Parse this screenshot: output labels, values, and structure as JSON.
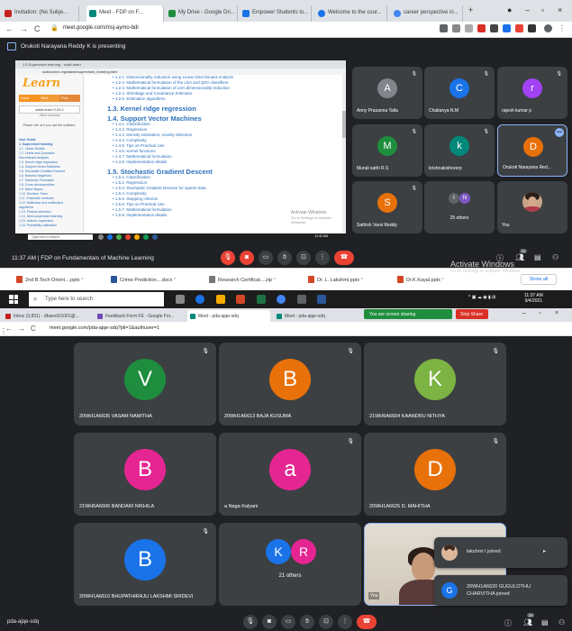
{
  "colors": {
    "meet_bg": "#202124",
    "tile_bg": "#3c4043",
    "end_call": "#ea4335",
    "accent_blue": "#8ab4f8",
    "sharing_green": "#1e8e3e"
  },
  "top": {
    "tabs": [
      {
        "label": "Invitation: (No Subje...",
        "fav": "#c5221f"
      },
      {
        "label": "Meet - FDP on F...",
        "fav": "#00897b"
      },
      {
        "label": "My Drive - Google Dri...",
        "fav": "#1e8e3e"
      },
      {
        "label": "Empower Students to...",
        "fav": "#1a73e8"
      },
      {
        "label": "Welcome to the cour...",
        "fav": "#1a73e8"
      },
      {
        "label": "career perspective in...",
        "fav": "#4285f4"
      }
    ],
    "url": "meet.google.com/msj-aymo-bdi",
    "presenting_text": "Orukoti Narayana Reddy K is presenting",
    "shared_screen": {
      "logo": "Learn",
      "nav": [
        "Home",
        "Next",
        "Prev"
      ],
      "version": "scikit-learn 0.24.2",
      "version_note": "Other versions",
      "note": "Please cite us if you use the software.",
      "toc": [
        "User Guide",
        "1. Supervised learning",
        "1.1. Linear Models",
        "1.2. Linear and Quadratic",
        "Discriminant Analysis",
        "1.3. Kernel ridge regression",
        "1.4. Support Vector Machines",
        "1.5. Stochastic Gradient Descent",
        "1.6. Nearest Neighbors",
        "1.7. Gaussian Processes",
        "1.8. Cross decomposition",
        "1.9. Naive Bayes",
        "1.10. Decision Trees",
        "1.11. Ensemble methods",
        "1.12. Multiclass and multioutput",
        "algorithms",
        "1.13. Feature selection",
        "1.14. Semi-supervised learning",
        "1.15. Isotonic regression",
        "1.16. Probability calibration"
      ],
      "doc_lines_a": [
        "1.2.1. Dimensionality reduction using Linear Discriminant Analysis",
        "1.2.2. Mathematical formulation of the LDA and QDA classifiers",
        "1.2.3. Mathematical formulation of LDA dimensionality reduction",
        "1.2.4. Shrinkage and Covariance Estimator",
        "1.2.5. Estimation algorithms"
      ],
      "heading_1": "1.3. Kernel ridge regression",
      "heading_2": "1.4. Support Vector Machines",
      "doc_lines_b": [
        "1.4.1. Classification",
        "1.4.2. Regression",
        "1.4.3. Density estimation, novelty detection",
        "1.4.4. Complexity",
        "1.4.5. Tips on Practical Use",
        "1.4.6. Kernel functions",
        "1.4.7. Mathematical formulation",
        "1.4.8. Implementation details"
      ],
      "heading_3": "1.5. Stochastic Gradient Descent",
      "doc_lines_c": [
        "1.5.1. Classification",
        "1.5.2. Regression",
        "1.5.3. Stochastic Gradient Descent for sparse data",
        "1.5.4. Complexity",
        "1.5.5. Stopping criterion",
        "1.5.6. Tips on Practical Use",
        "1.5.7. Mathematical formulation",
        "1.5.8. Implementation details"
      ],
      "watermark": "Activate Windows",
      "watermark_sub": "Go to Settings to activate Windows",
      "taskbar_search": "Type here to search",
      "taskbar_time": "11:42 AM"
    },
    "tiles": [
      {
        "initial": "A",
        "name": "Anny Prasanna Talla",
        "color": "#80868b"
      },
      {
        "initial": "C",
        "name": "Chaitanya N.M",
        "color": "#1a73e8"
      },
      {
        "initial": "r",
        "name": "rajesh kumar p",
        "color": "#a142f4"
      },
      {
        "initial": "M",
        "name": "Murali sathi R.S",
        "color": "#1e8e3e"
      },
      {
        "initial": "k",
        "name": "krishnakishorerp",
        "color": "#00897b"
      },
      {
        "initial": "D",
        "name": "Orukoti Narayana Red...",
        "color": "#e8710a"
      },
      {
        "initial": "S",
        "name": "Sathish Varsi Reddy",
        "color": "#e8710a"
      },
      {
        "name": "25 others",
        "initial_a": "I",
        "initial_b": "N"
      },
      {
        "name": "You"
      }
    ],
    "meeting_title": "11:37 AM  |  FDP on Fundamentals of Machine Learning",
    "participant_count": "31",
    "activate_windows": "Activate Windows",
    "activate_windows_sub": "Go to Settings to activate Windows",
    "downloads": [
      {
        "label": "2nd B.Tech Orient....pptx",
        "color": "#d24726"
      },
      {
        "label": "Crime Prediction....docx",
        "color": "#2b579a"
      },
      {
        "label": "Research Certificat....zip",
        "color": "#777777"
      },
      {
        "label": "Dr. L. Lakshmi.pptx",
        "color": "#d24726"
      },
      {
        "label": "Dr.K.Kayal.pptx",
        "color": "#d24726"
      }
    ],
    "show_all": "Show all",
    "taskbar_search": "Type here to search",
    "clock_time": "11:37 AM",
    "clock_date": "9/4/2021"
  },
  "bottom": {
    "tabs": [
      {
        "label": "Inbox (3,831) - dhaexit11001@...",
        "fav": "#c5221f"
      },
      {
        "label": "Feedback Form FE - Google For...",
        "fav": "#7248b9"
      },
      {
        "label": "Meet - pda-ajqe-sdq",
        "fav": "#00897b"
      },
      {
        "label": "Meet - pda-ajqe-sdq",
        "fav": "#00897b"
      }
    ],
    "sharing_label": "You are screen sharing",
    "stop_share": "Stop Share",
    "url": "meet.google.com/pda-ajqe-sdq?pli=1&authuser=1",
    "tiles": [
      {
        "initial": "V",
        "name": "20WH1A6635 VASAM NAMITHA",
        "color": "#1e8e3e"
      },
      {
        "initial": "B",
        "name": "20WH1A6613 BAJA KUSUMA",
        "color": "#e8710a"
      },
      {
        "initial": "K",
        "name": "21WH5A6604 KAANDRU NITHYA",
        "color": "#7cb342"
      },
      {
        "initial": "B",
        "name": "21WH5A6606 BANDARI NIKHILA",
        "color": "#e52592"
      },
      {
        "initial": "a",
        "name": "a Naga Kalyani",
        "color": "#e52592"
      },
      {
        "initial": "D",
        "name": "20WH1A6625 D. MAHITHA",
        "color": "#e8710a"
      },
      {
        "initial": "B",
        "name": "20WH1A6610 BHUPATHIRAJU LAKSHMI SRIDEVI",
        "color": "#1a73e8"
      },
      {
        "name": "21 others",
        "initial_a": "K",
        "initial_b": "R"
      }
    ],
    "self_label": "You",
    "toast_1": "lakshmi l joined",
    "toast_2_line1": "20WH1A6620 GUGULOTHU",
    "toast_2_line2": "CHARVITHA joined",
    "toast_2_initial": "G",
    "meeting_code": "pda-ajqe-sdq",
    "participant_count": "29"
  }
}
